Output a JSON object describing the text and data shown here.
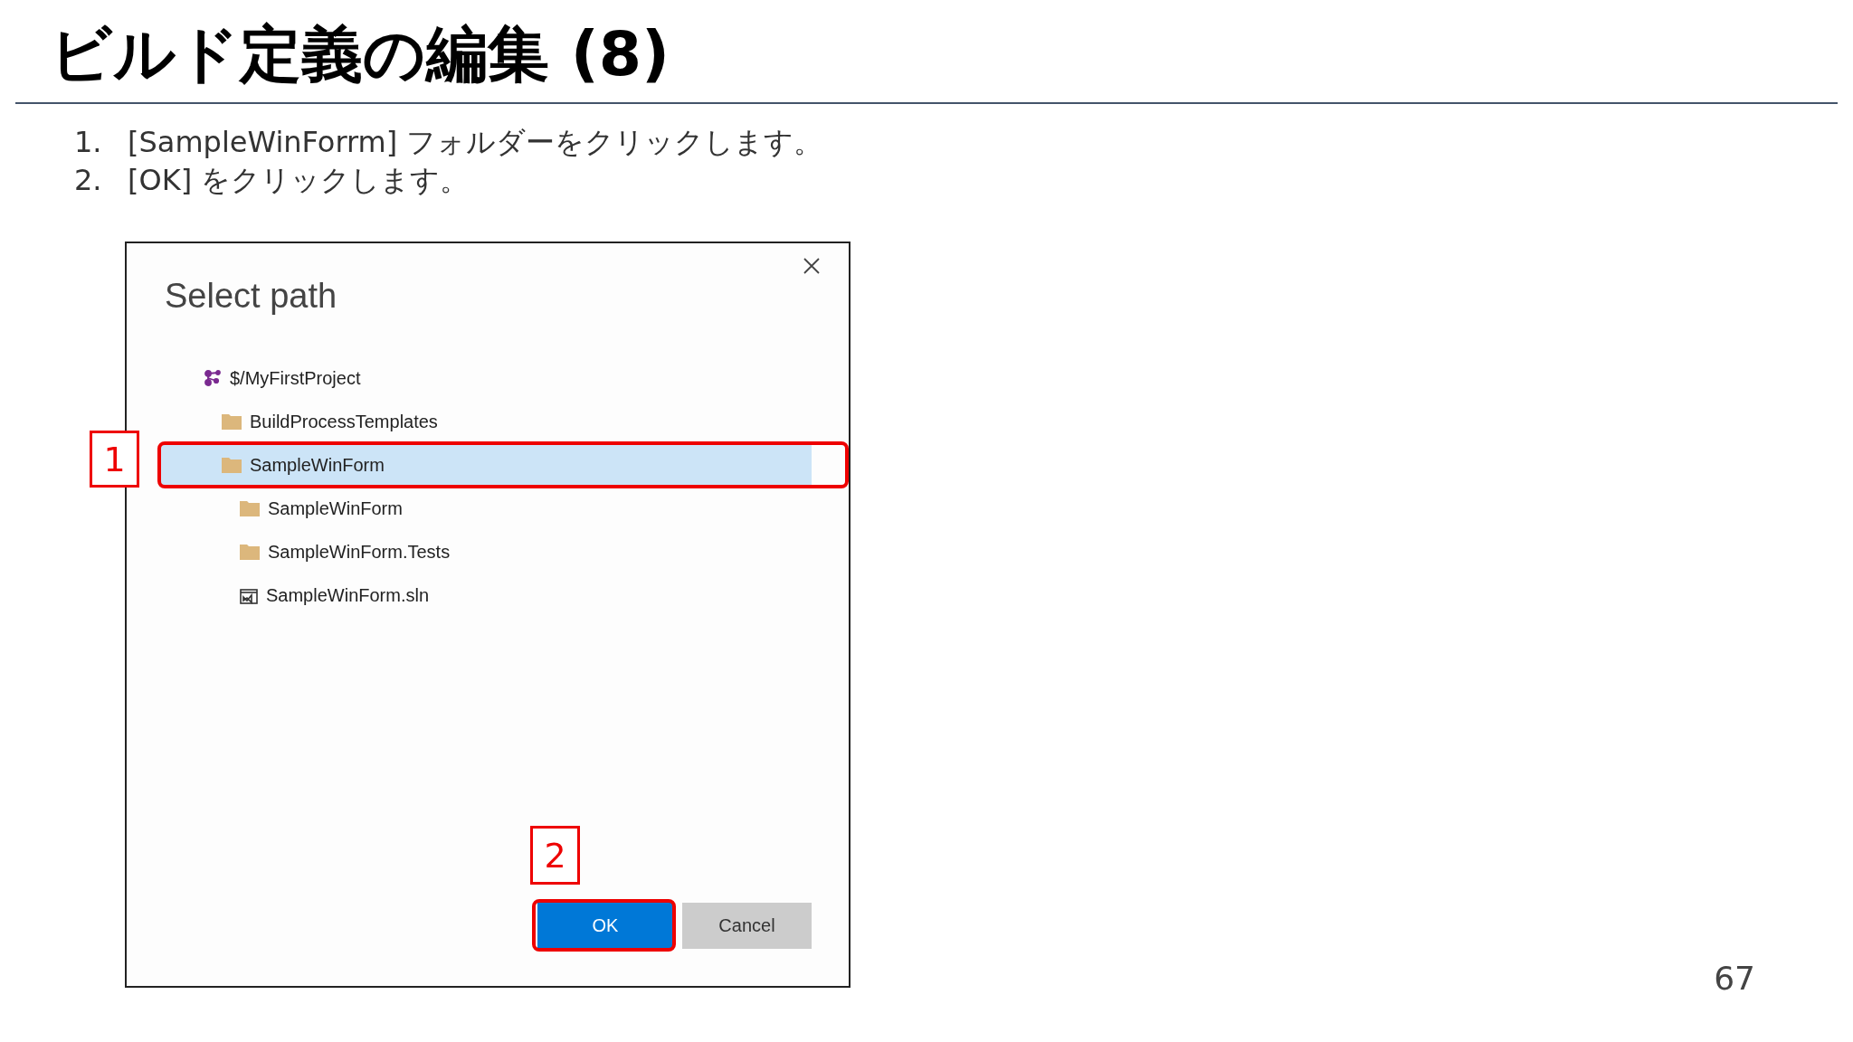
{
  "slide": {
    "title": "ビルド定義の編集 (8)",
    "steps": [
      {
        "number": "1.",
        "text": "[SampleWinForrm] フォルダーをクリックします。"
      },
      {
        "number": "2.",
        "text": "[OK] をクリックします。"
      }
    ]
  },
  "dialog": {
    "title": "Select path",
    "tree": [
      {
        "kind": "project",
        "label": "$/MyFirstProject",
        "selected": false,
        "children": [
          {
            "kind": "folder",
            "label": "BuildProcessTemplates",
            "selected": false
          },
          {
            "kind": "folder",
            "label": "SampleWinForm",
            "selected": true,
            "callout": "1",
            "children": [
              {
                "kind": "folder",
                "label": "SampleWinForm",
                "selected": false
              },
              {
                "kind": "folder",
                "label": "SampleWinForm.Tests",
                "selected": false
              },
              {
                "kind": "solution",
                "label": "SampleWinForm.sln",
                "selected": false
              }
            ]
          }
        ]
      }
    ],
    "buttons": [
      {
        "kind": "primary",
        "label": "OK",
        "callout": "2"
      },
      {
        "kind": "secondary",
        "label": "Cancel"
      }
    ]
  },
  "page_number": "67"
}
